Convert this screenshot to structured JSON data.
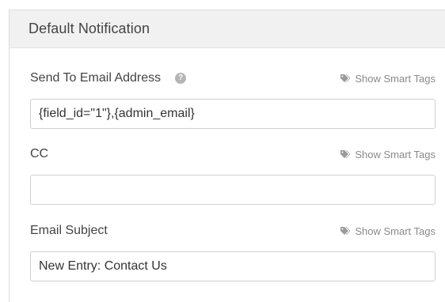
{
  "panel": {
    "title": "Default Notification"
  },
  "smart_tags_label": "Show Smart Tags",
  "fields": [
    {
      "label": "Send To Email Address",
      "value": "{field_id=\"1\"},{admin_email}",
      "has_help": true,
      "help_icon": "question-circle-icon"
    },
    {
      "label": "CC",
      "value": "",
      "has_help": false
    },
    {
      "label": "Email Subject",
      "value": "New Entry: Contact Us",
      "has_help": false
    }
  ],
  "colors": {
    "header_bg": "#f1f1f1",
    "label_text": "#444444",
    "muted_text": "#8a8a8a",
    "border": "#cfcfcf"
  }
}
